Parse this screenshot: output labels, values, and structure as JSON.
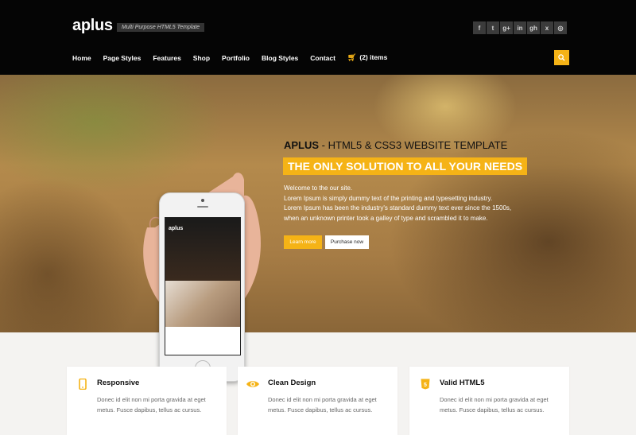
{
  "header": {
    "logo": "aplus",
    "tagline": "Multi Purpose HTML5 Template",
    "socials": [
      {
        "icon": "facebook-icon",
        "glyph": "f"
      },
      {
        "icon": "twitter-icon",
        "glyph": "t"
      },
      {
        "icon": "google-plus-icon",
        "glyph": "g+"
      },
      {
        "icon": "linkedin-icon",
        "glyph": "in"
      },
      {
        "icon": "github-icon",
        "glyph": "gh"
      },
      {
        "icon": "xing-icon",
        "glyph": "x"
      },
      {
        "icon": "dribbble-icon",
        "glyph": "◎"
      }
    ],
    "nav": [
      "Home",
      "Page Styles",
      "Features",
      "Shop",
      "Portfolio",
      "Blog Styles",
      "Contact"
    ],
    "cart_label": "(2) items"
  },
  "hero": {
    "title_bold": "APLUS",
    "title_rest": " - HTML5 & CSS3 WEBSITE TEMPLATE",
    "banner": "THE ONLY SOLUTION TO ALL YOUR NEEDS",
    "lines": [
      "Welcome to the our site.",
      "Lorem Ipsum is simply dummy text of the printing and typesetting industry.",
      "Lorem Ipsum has been the industry's standard dummy text ever since the 1500s,",
      "when an unknown printer took a galley of type and scrambled it to make."
    ],
    "learn_btn": "Learn more",
    "purchase_btn": "Purchase now",
    "phone": {
      "logo": "aplus"
    }
  },
  "features": [
    {
      "title": "Responsive",
      "icon": "mobile-icon",
      "text": "Donec id elit non mi porta gravida at eget metus. Fusce dapibus, tellus ac cursus."
    },
    {
      "title": "Clean Design",
      "icon": "eye-icon",
      "text": "Donec id elit non mi porta gravida at eget metus. Fusce dapibus, tellus ac cursus."
    },
    {
      "title": "Valid HTML5",
      "icon": "html5-icon",
      "text": "Donec id elit non mi porta gravida at eget metus. Fusce dapibus, tellus ac cursus."
    }
  ],
  "colors": {
    "accent": "#f5b316",
    "header": "#050505"
  }
}
